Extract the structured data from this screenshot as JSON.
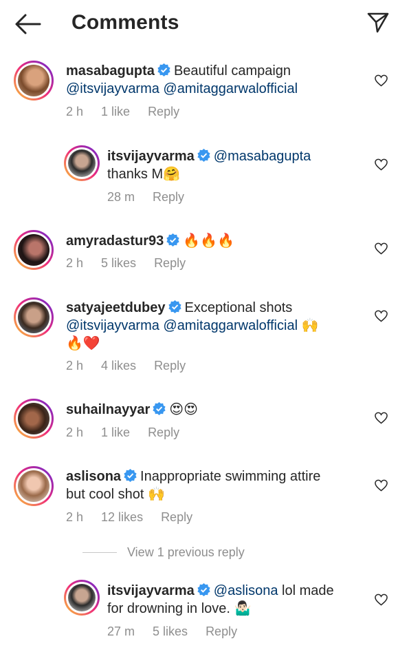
{
  "header": {
    "title": "Comments",
    "back_icon": "arrow-left-icon",
    "share_icon": "paper-plane-icon"
  },
  "colors": {
    "mention": "#00376b",
    "meta": "#8e8e8e",
    "verified": "#3897f0"
  },
  "comments": [
    {
      "username": "masabagupta",
      "text": "Beautiful campaign",
      "mentions": "@itsvijayvarma @amitaggarwalofficial",
      "time": "2 h",
      "likes": "1 like",
      "reply": "Reply"
    },
    {
      "username": "itsvijayvarma",
      "mention": "@masabagupta",
      "text": "thanks M🤗",
      "time": "28 m",
      "reply": "Reply"
    },
    {
      "username": "amyradastur93",
      "text": "🔥🔥🔥",
      "time": "2 h",
      "likes": "5 likes",
      "reply": "Reply"
    },
    {
      "username": "satyajeetdubey",
      "text": "Exceptional shots",
      "mentions": "@itsvijayvarma @amitaggarwalofficial",
      "emoji_tail": "🙌",
      "line3": "🔥❤️",
      "time": "2 h",
      "likes": "4 likes",
      "reply": "Reply"
    },
    {
      "username": "suhailnayyar",
      "text": "😍😍",
      "time": "2 h",
      "likes": "1 like",
      "reply": "Reply"
    },
    {
      "username": "aslisona",
      "text": "Inappropriate swimming attire",
      "line2": "but cool shot 🙌",
      "time": "2 h",
      "likes": "12 likes",
      "reply": "Reply"
    },
    {
      "username": "itsvijayvarma",
      "mention": "@aslisona",
      "text": "lol made",
      "line2": "for drowning in love. 🤷🏻‍♂️",
      "time": "27 m",
      "likes": "5 likes",
      "reply": "Reply"
    }
  ],
  "view_previous": "View 1 previous reply"
}
